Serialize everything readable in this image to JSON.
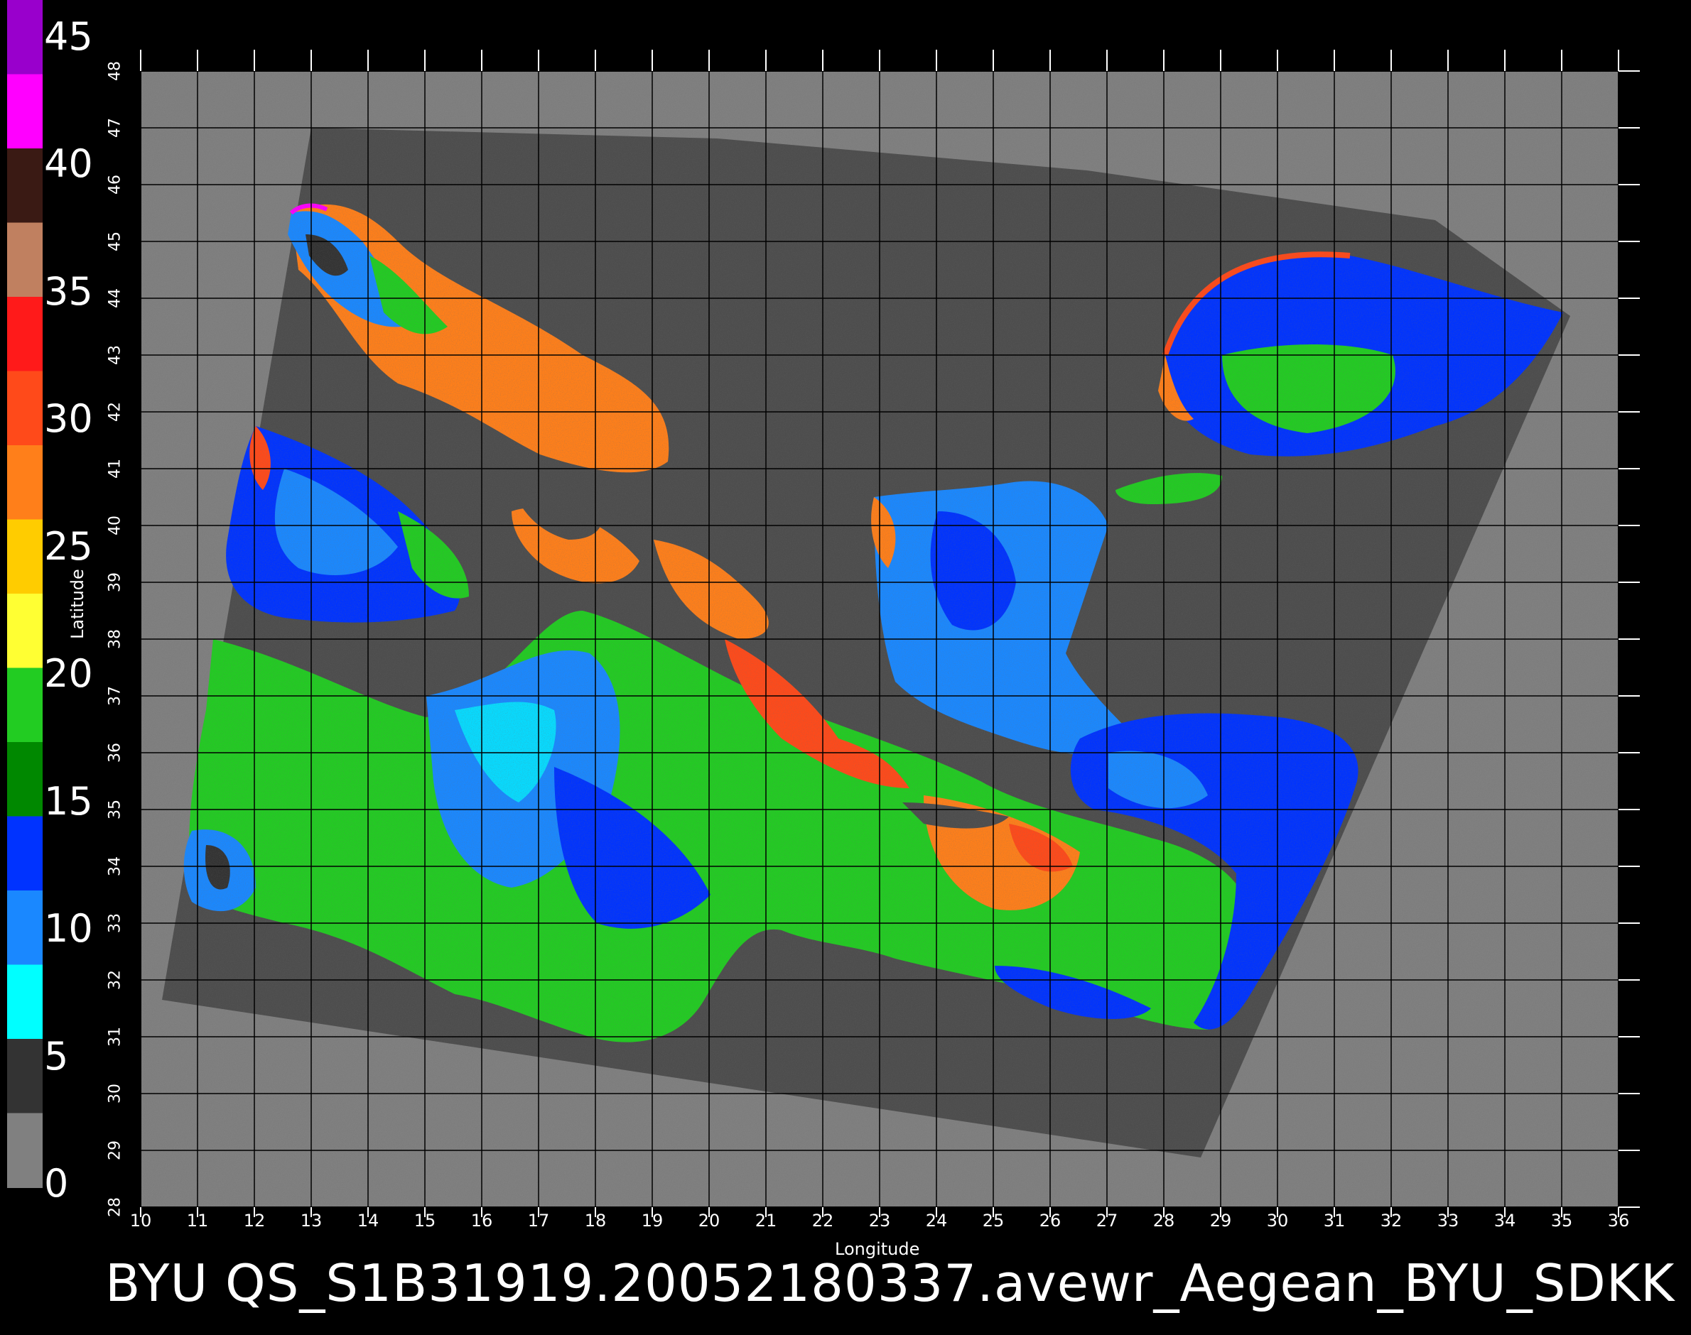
{
  "colorbar": {
    "labels": [
      "45",
      "40",
      "35",
      "30",
      "25",
      "20",
      "15",
      "10",
      "5",
      "0"
    ],
    "stops": [
      {
        "color": "#9900cc",
        "label": "45"
      },
      {
        "color": "#ff00ff",
        "label": "40"
      },
      {
        "color": "#3a1a14",
        "label": ""
      },
      {
        "color": "#c08060",
        "label": "35"
      },
      {
        "color": "#ff1a1a",
        "label": "30"
      },
      {
        "color": "#ff4a1a",
        "label": ""
      },
      {
        "color": "#ff7f1a",
        "label": "25"
      },
      {
        "color": "#ffcc00",
        "label": ""
      },
      {
        "color": "#ffff33",
        "label": "20"
      },
      {
        "color": "#22cc22",
        "label": ""
      },
      {
        "color": "#008800",
        "label": "15"
      },
      {
        "color": "#0033ff",
        "label": ""
      },
      {
        "color": "#1a88ff",
        "label": "10"
      },
      {
        "color": "#00ffff",
        "label": "5"
      },
      {
        "color": "#333333",
        "label": ""
      },
      {
        "color": "#808080",
        "label": "0"
      }
    ]
  },
  "map": {
    "lon_ticks": [
      "10",
      "11",
      "12",
      "13",
      "14",
      "15",
      "16",
      "17",
      "18",
      "19",
      "20",
      "21",
      "22",
      "23",
      "24",
      "25",
      "26",
      "27",
      "28",
      "29",
      "30",
      "31",
      "32",
      "33",
      "34",
      "35",
      "36"
    ],
    "lat_ticks": [
      "28",
      "29",
      "30",
      "31",
      "32",
      "33",
      "34",
      "35",
      "36",
      "37",
      "38",
      "39",
      "40",
      "41",
      "42",
      "43",
      "44",
      "45",
      "46",
      "47",
      "48"
    ],
    "xlabel": "Longitude",
    "ylabel": "Latitude",
    "background_color": "#808080",
    "swath_color": "#4d4d4d",
    "grid_color": "#000000"
  },
  "footer": {
    "text": "BYU  QS_S1B31919.20052180337.avewr_Aegean_BYU_SDKK"
  }
}
